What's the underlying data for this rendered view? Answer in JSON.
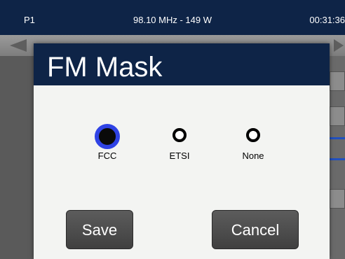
{
  "status_bar": {
    "program": "P1",
    "frequency_power": "98.10 MHz - 149 W",
    "clock": "00:31:36"
  },
  "dialog": {
    "title": "FM Mask",
    "options": [
      {
        "label": "FCC",
        "selected": true
      },
      {
        "label": "ETSI",
        "selected": false
      },
      {
        "label": "None",
        "selected": false
      }
    ],
    "save_label": "Save",
    "cancel_label": "Cancel"
  },
  "colors": {
    "header_bg": "#0e2447",
    "dialog_bg": "#f3f4f2",
    "selected_ring": "#2f43e5",
    "button_bg": "#4e4e4e"
  }
}
